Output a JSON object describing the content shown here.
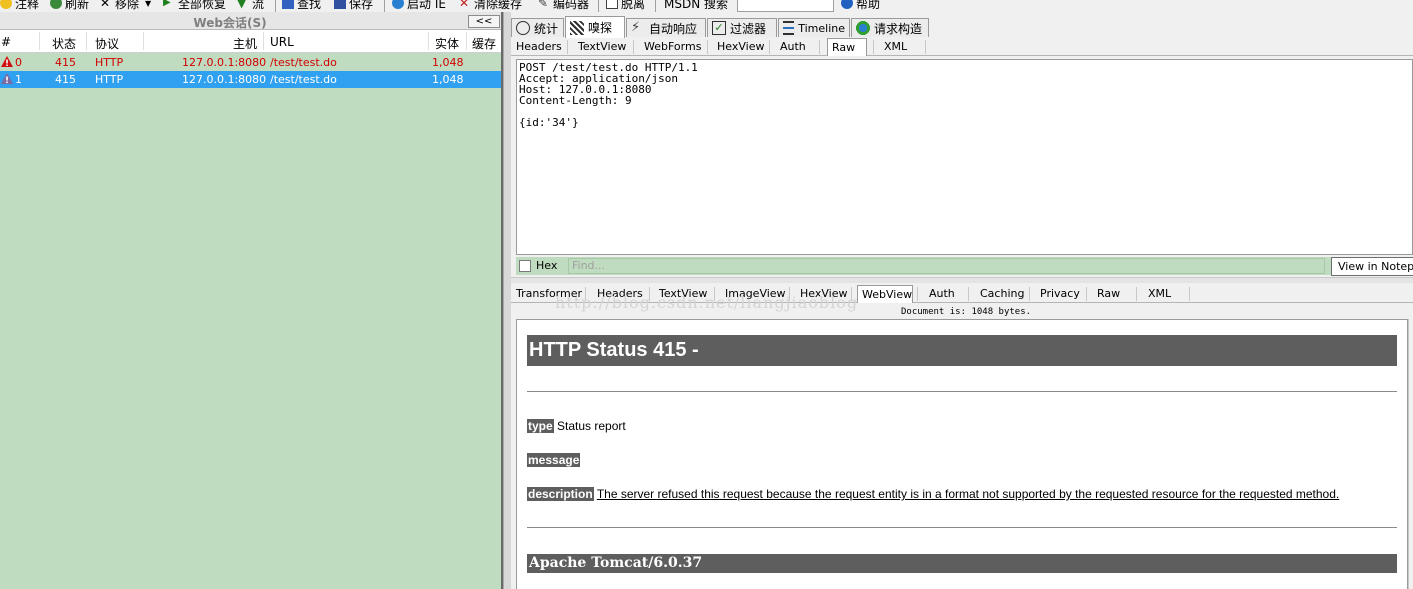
{
  "toolbar": {
    "items": [
      {
        "label": "注释",
        "icon": "comment-icon"
      },
      {
        "label": "刷新",
        "icon": "refresh-icon"
      },
      {
        "label": "移除",
        "icon": "remove-icon"
      },
      {
        "label": "全部恢复",
        "icon": "resume-all-icon"
      },
      {
        "label": "流",
        "icon": "stream-icon"
      },
      {
        "label": "查找",
        "icon": "find-icon"
      },
      {
        "label": "保存",
        "icon": "save-icon"
      },
      {
        "label": "启动 IE",
        "icon": "launch-ie-icon"
      },
      {
        "label": "清除缓存",
        "icon": "clear-cache-icon"
      },
      {
        "label": "编码器",
        "icon": "encoder-icon"
      },
      {
        "label": "脱离",
        "icon": "detach-icon"
      },
      {
        "label": "MSDN 搜索",
        "icon": ""
      },
      {
        "label": "帮助",
        "icon": "help-icon"
      }
    ]
  },
  "sessions": {
    "title": "Web会话(S)",
    "collapse_label": "<<",
    "columns": [
      "#",
      "状态",
      "协议",
      "主机",
      "URL",
      "实体",
      "缓存"
    ],
    "rows": [
      {
        "num": "0",
        "status": "415",
        "protocol": "HTTP",
        "host": "127.0.0.1:8080",
        "url": "/test/test.do",
        "body": "1,048",
        "caching": "",
        "icon": "error-icon"
      },
      {
        "num": "1",
        "status": "415",
        "protocol": "HTTP",
        "host": "127.0.0.1:8080",
        "url": "/test/test.do",
        "body": "1,048",
        "caching": "",
        "icon": "warning-icon"
      }
    ]
  },
  "main_tabs": [
    {
      "label": "统计",
      "icon": "timer-icon"
    },
    {
      "label": "嗅探",
      "icon": "inspector-icon",
      "active": true
    },
    {
      "label": "自动响应",
      "icon": "autoresponder-icon"
    },
    {
      "label": "过滤器",
      "icon": "filter-icon"
    },
    {
      "label": "Timeline",
      "icon": "timeline-icon"
    },
    {
      "label": "请求构造",
      "icon": "composer-icon"
    }
  ],
  "request_tabs": [
    "Headers",
    "TextView",
    "WebForms",
    "HexView",
    "Auth",
    "Raw",
    "XML"
  ],
  "request_active": "Raw",
  "request_raw": "POST /test/test.do HTTP/1.1\nAccept: application/json\nHost: 127.0.0.1:8080\nContent-Length: 9\n\n{id:'34'}",
  "hexbar": {
    "hex_label": "Hex",
    "find_placeholder": "Find...",
    "notepad_label": "View in Notepad"
  },
  "response_tabs": [
    "Transformer",
    "Headers",
    "TextView",
    "ImageView",
    "HexView",
    "WebView",
    "Auth",
    "Caching",
    "Privacy",
    "Raw",
    "XML"
  ],
  "response_active": "WebView",
  "doc_info": "Document is: 1048 bytes.",
  "watermark": "http://blog.csdn.net/liangjiaoblog",
  "webview": {
    "heading": "HTTP Status 415 -",
    "type_label": "type",
    "type_value": "Status report",
    "message_label": "message",
    "message_value": "",
    "description_label": "description",
    "description_value": "The server refused this request because the request entity is in a format not supported by the requested resource for the requested method.",
    "footer": "Apache Tomcat/6.0.37"
  }
}
